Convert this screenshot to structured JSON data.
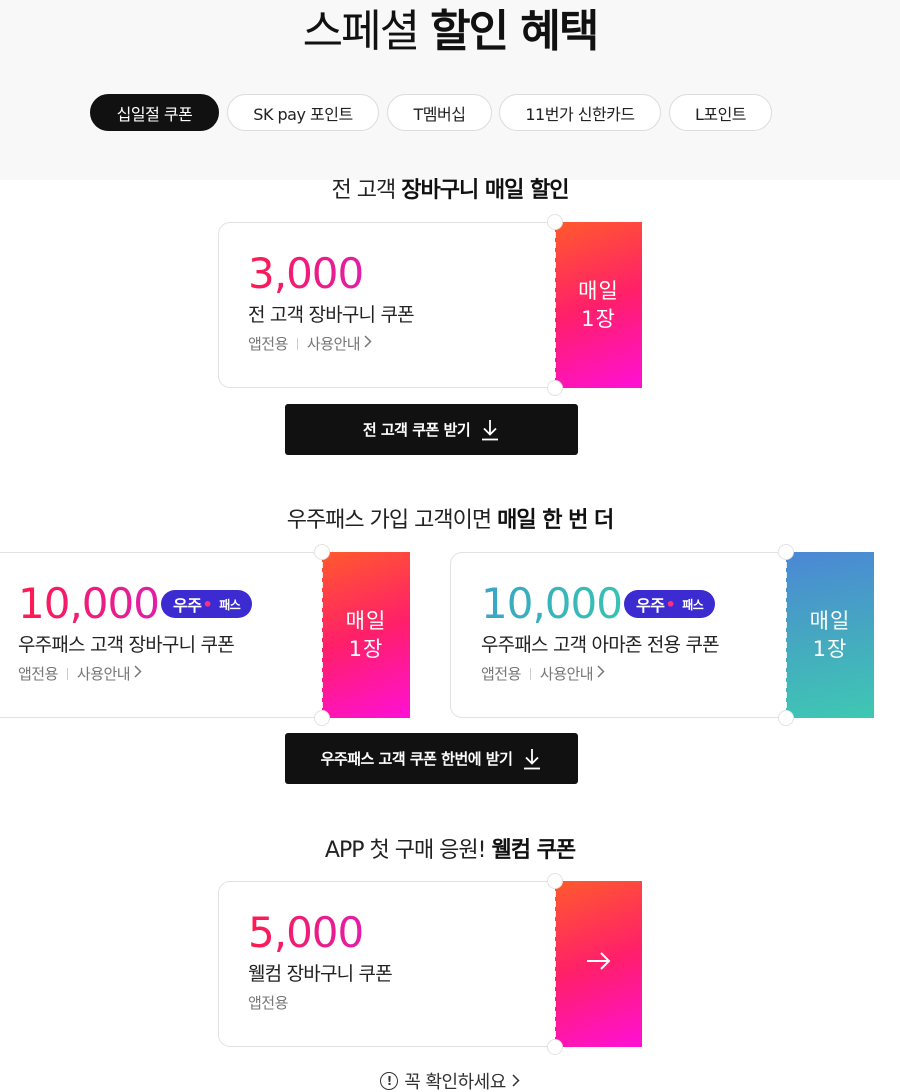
{
  "header": {
    "title_light": "스페셜",
    "title_bold": "할인 혜택"
  },
  "tabs": [
    {
      "label": "십일절 쿠폰",
      "active": true
    },
    {
      "label": "SK pay 포인트",
      "active": false
    },
    {
      "label": "T멤버십",
      "active": false
    },
    {
      "label": "11번가 신한카드",
      "active": false
    },
    {
      "label": "L포인트",
      "active": false
    }
  ],
  "section1": {
    "title_light": "전 고객",
    "title_bold": "장바구니 매일 할인",
    "coupon": {
      "amount": "3,000",
      "name": "전 고객 장바구니 쿠폰",
      "meta_app": "앱전용",
      "meta_guide": "사용안내",
      "stub_line1": "매일",
      "stub_line2": "1장"
    },
    "button_label": "전 고객 쿠폰 받기"
  },
  "section2": {
    "title_light": "우주패스 가입 고객이면",
    "title_bold": "매일 한 번 더",
    "coupons": [
      {
        "amount": "10,000",
        "badge_main": "우주",
        "badge_sub": "패스",
        "name": "우주패스 고객 장바구니 쿠폰",
        "meta_app": "앱전용",
        "meta_guide": "사용안내",
        "stub_line1": "매일",
        "stub_line2": "1장"
      },
      {
        "amount": "10,000",
        "badge_main": "우주",
        "badge_sub": "패스",
        "name": "우주패스 고객 아마존 전용 쿠폰",
        "meta_app": "앱전용",
        "meta_guide": "사용안내",
        "stub_line1": "매일",
        "stub_line2": "1장"
      }
    ],
    "button_label": "우주패스 고객 쿠폰 한번에 받기"
  },
  "section3": {
    "title_light": "APP 첫 구매 응원!",
    "title_bold": "웰컴 쿠폰",
    "coupon": {
      "amount": "5,000",
      "name": "웰컴 장바구니 쿠폰",
      "meta_app": "앱전용"
    }
  },
  "footer": {
    "note": "꼭 확인하세요",
    "info_glyph": "!"
  },
  "colors": {
    "accent_red": "#ff1f6a",
    "accent_pink": "#ff10d6",
    "accent_blue": "#4b87d6",
    "accent_teal": "#3ec8b3",
    "badge": "#3b2bd0",
    "button": "#111111"
  }
}
